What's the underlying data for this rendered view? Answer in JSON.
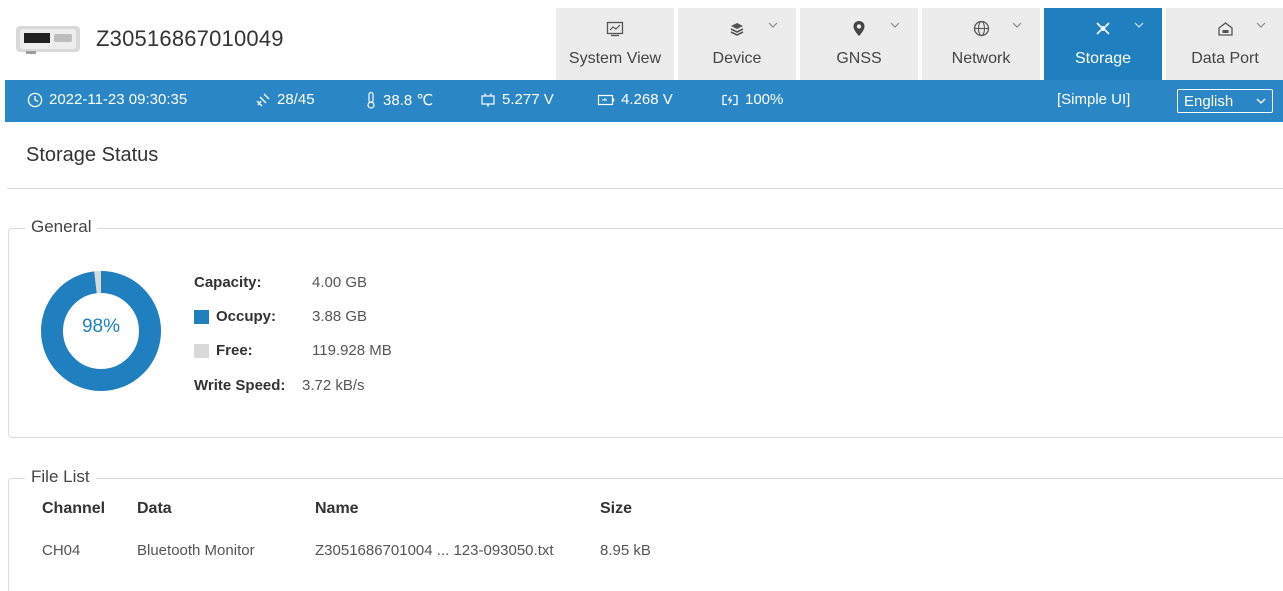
{
  "header": {
    "device_id": "Z30516867010049"
  },
  "tabs": [
    {
      "label": "System View",
      "icon": "monitor-icon",
      "has_menu": false,
      "active": false
    },
    {
      "label": "Device",
      "icon": "layers-icon",
      "has_menu": true,
      "active": false
    },
    {
      "label": "GNSS",
      "icon": "location-pin-icon",
      "has_menu": true,
      "active": false
    },
    {
      "label": "Network",
      "icon": "globe-icon",
      "has_menu": true,
      "active": false
    },
    {
      "label": "Storage",
      "icon": "storage-icon",
      "has_menu": true,
      "active": true
    },
    {
      "label": "Data Port",
      "icon": "port-icon",
      "has_menu": true,
      "active": false
    }
  ],
  "status": {
    "datetime": "2022-11-23 09:30:35",
    "satellites": "28/45",
    "temperature": "38.8 ℃",
    "voltage_in": "5.277 V",
    "voltage_battery": "4.268 V",
    "battery": "100%",
    "simple_ui": "[Simple UI]",
    "language": "English"
  },
  "page": {
    "title": "Storage Status"
  },
  "general": {
    "legend": "General",
    "used_percent": 98,
    "used_percent_text": "98%",
    "capacity_label": "Capacity:",
    "capacity_value": "4.00 GB",
    "occupy_label": "Occupy:",
    "occupy_value": "3.88 GB",
    "free_label": "Free:",
    "free_value": "119.928 MB",
    "speed_label": "Write Speed:",
    "speed_value": "3.72 kB/s",
    "colors": {
      "occupy": "#1f7fbf",
      "free": "#d9d9d9"
    }
  },
  "file_list": {
    "legend": "File List",
    "headers": {
      "channel": "Channel",
      "data": "Data",
      "name": "Name",
      "size": "Size"
    },
    "rows": [
      {
        "channel": "CH04",
        "data": "Bluetooth Monitor",
        "name": "Z3051686701004 ... 123-093050.txt",
        "size": "8.95 kB"
      }
    ]
  },
  "colors": {
    "accent": "#2a86c4",
    "tab_active": "#1f7fbf",
    "tab_inactive": "#ececec"
  }
}
